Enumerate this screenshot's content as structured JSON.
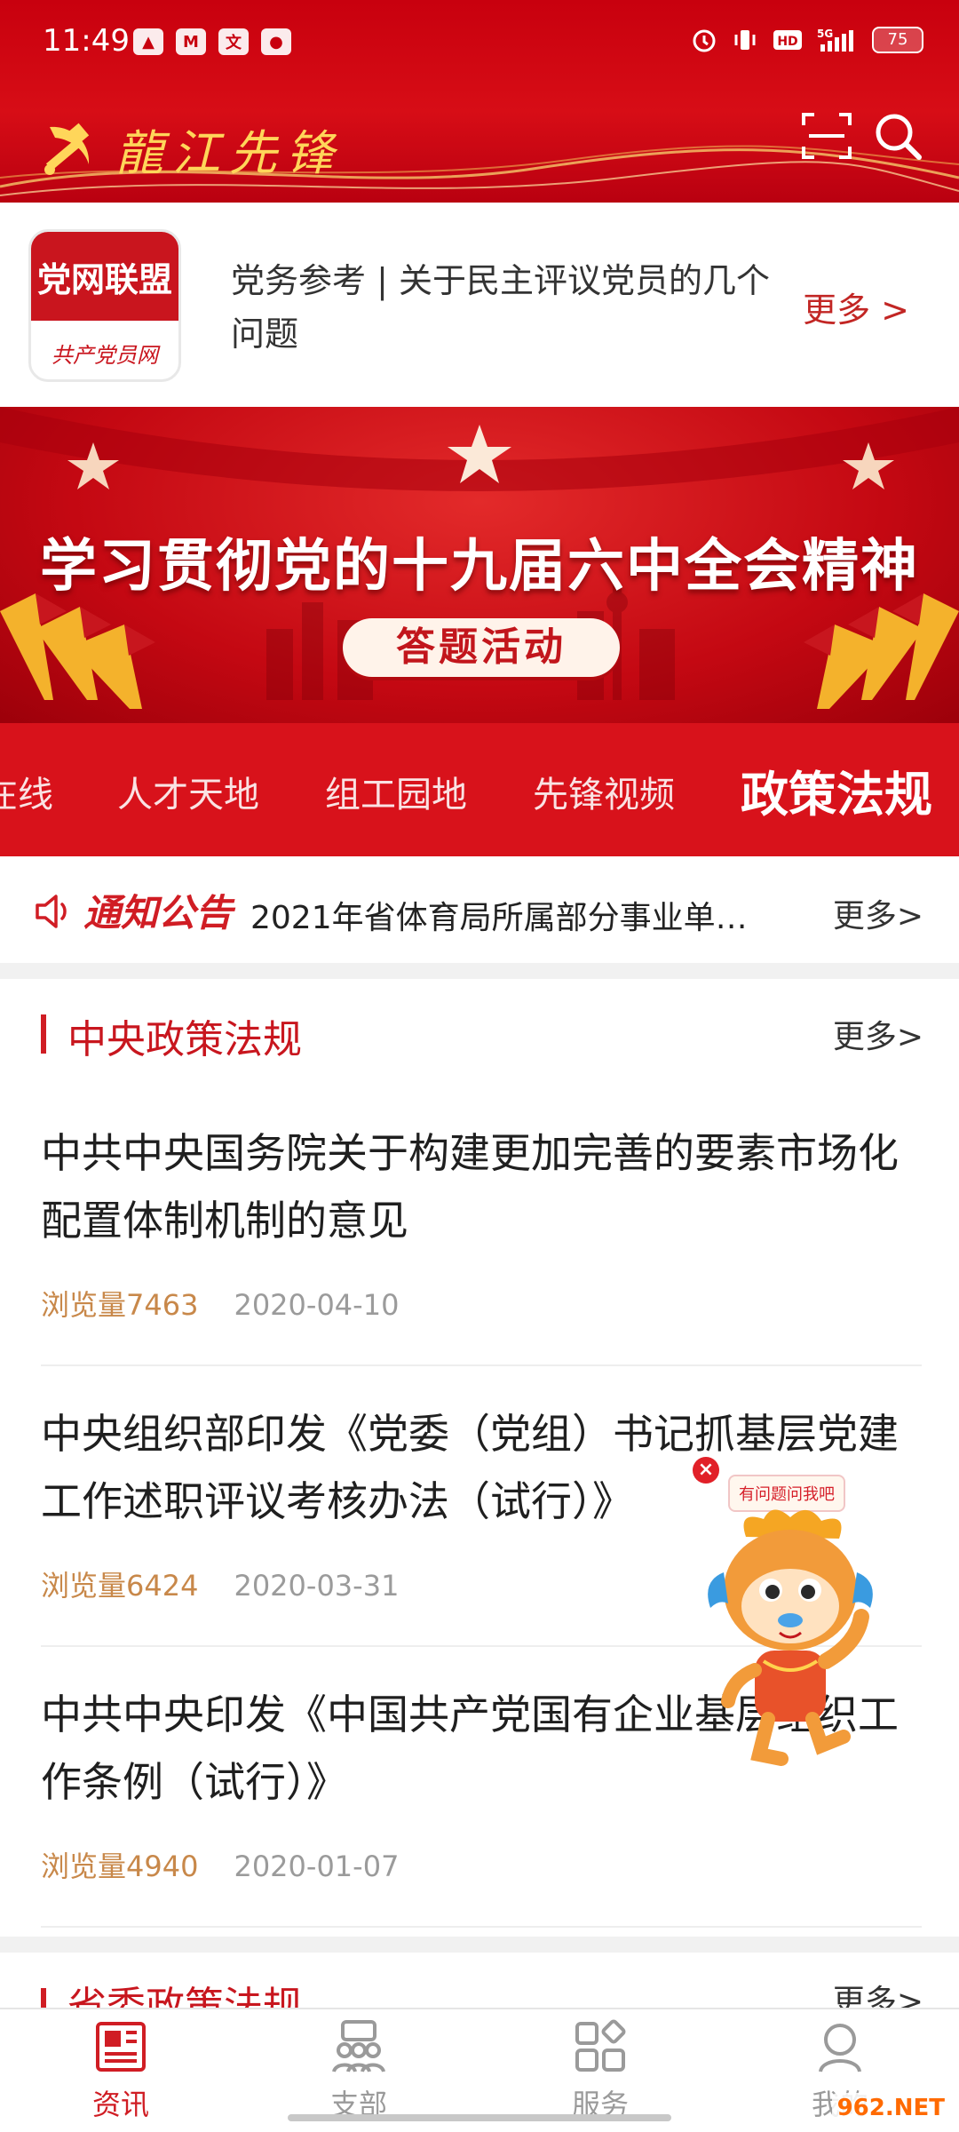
{
  "status_bar": {
    "time": "11:49",
    "battery": "75"
  },
  "header": {
    "logo_text": "龍江先锋"
  },
  "top_card": {
    "logo_title": "党网联盟",
    "logo_subtitle": "共产党员网",
    "title": "党务参考 | 关于民主评议党员的几个问题",
    "more": "更多 >"
  },
  "banner": {
    "title": "学习贯彻党的十九届六中全会精神",
    "button": "答题活动"
  },
  "tabs": [
    {
      "label": "在线"
    },
    {
      "label": "人才天地"
    },
    {
      "label": "组工园地"
    },
    {
      "label": "先锋视频"
    },
    {
      "label": "政策法规",
      "active": true
    }
  ],
  "notice": {
    "label": "通知公告",
    "text": "2021年省体育局所属部分事业单…",
    "more": "更多>"
  },
  "section": {
    "title": "中央政策法规",
    "more": "更多>",
    "articles": [
      {
        "title": "中共中央国务院关于构建更加完善的要素市场化配置体制机制的意见",
        "views": "浏览量7463",
        "date": "2020-04-10"
      },
      {
        "title": "中央组织部印发《党委（党组）书记抓基层党建工作述职评议考核办法（试行）》",
        "views": "浏览量6424",
        "date": "2020-03-31"
      },
      {
        "title": "中共中央印发《中国共产党国有企业基层组织工作条例（试行）》",
        "views": "浏览量4940",
        "date": "2020-01-07"
      }
    ]
  },
  "section2": {
    "title": "省委政策法规",
    "more": "更多>"
  },
  "mascot": {
    "bubble": "有问题问我吧",
    "close": "×"
  },
  "bottom_nav": [
    {
      "label": "资讯",
      "active": true,
      "icon": "news-icon"
    },
    {
      "label": "支部",
      "icon": "branch-icon"
    },
    {
      "label": "服务",
      "icon": "service-icon"
    },
    {
      "label": "我的",
      "icon": "user-icon"
    }
  ],
  "watermark": "962.NET",
  "colors": {
    "primary_red": "#d8121b",
    "text_red": "#c8161e",
    "views": "#c8884a"
  }
}
